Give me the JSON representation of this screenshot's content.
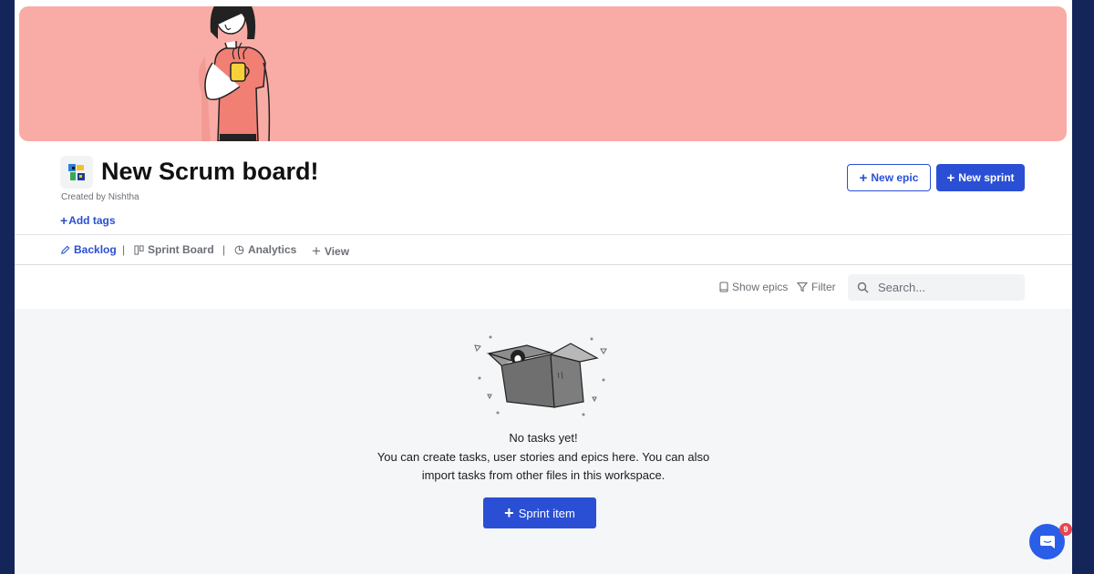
{
  "board": {
    "title": "New Scrum board!",
    "created_by": "Created by Nishtha",
    "add_tags_label": "Add tags",
    "icon": "board-emoji-icon"
  },
  "actions": {
    "new_epic_label": "New epic",
    "new_sprint_label": "New sprint"
  },
  "tabs": [
    {
      "label": "Backlog",
      "icon": "pencil-icon",
      "active": true
    },
    {
      "label": "Sprint Board",
      "icon": "kanban-icon",
      "active": false
    },
    {
      "label": "Analytics",
      "icon": "pie-chart-icon",
      "active": false
    },
    {
      "label": "View",
      "icon": "plus-icon",
      "active": false
    }
  ],
  "tab_separator": "|",
  "toolbar": {
    "show_epics_label": "Show epics",
    "filter_label": "Filter",
    "search_placeholder": "Search..."
  },
  "empty_state": {
    "title": "No tasks yet!",
    "line1": "You can create tasks, user stories and epics here. You can also",
    "line2": "import tasks from other files in this workspace.",
    "button_label": "Sprint item"
  },
  "chat": {
    "badge_count": "9"
  },
  "colors": {
    "accent": "#2a4fd4",
    "banner": "#f9aca5",
    "page_bg": "#14255a",
    "content_bg": "#f5f6f8"
  }
}
